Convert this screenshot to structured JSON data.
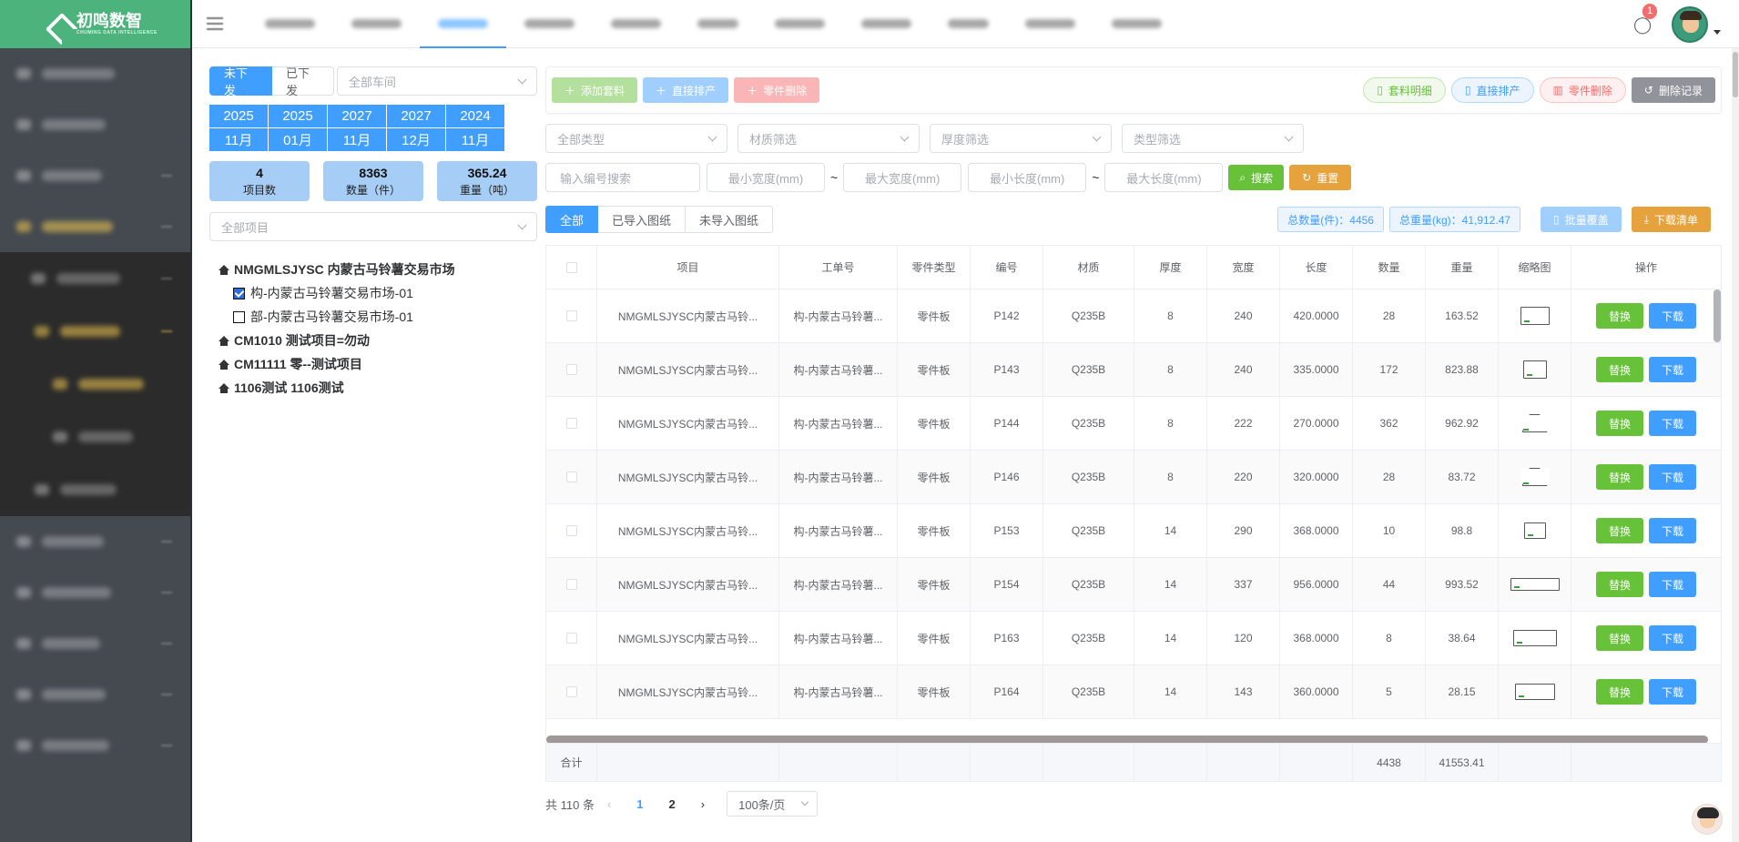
{
  "app": {
    "logo_text": "初鸣数智",
    "logo_sub": "CHUMING DATA INTELLIGENCE",
    "notification_count": "1"
  },
  "left": {
    "tabs": [
      "未下发",
      "已下发"
    ],
    "workshop_placeholder": "全部车间",
    "dates": [
      {
        "year": "2025",
        "month": "11月"
      },
      {
        "year": "2025",
        "month": "01月"
      },
      {
        "year": "2027",
        "month": "11月"
      },
      {
        "year": "2027",
        "month": "12月"
      },
      {
        "year": "2024",
        "month": "11月"
      }
    ],
    "stats": [
      {
        "value": "4",
        "label": "项目数"
      },
      {
        "value": "8363",
        "label": "数量（件）"
      },
      {
        "value": "365.24",
        "label": "重量（吨）"
      }
    ],
    "project_placeholder": "全部项目",
    "tree": {
      "root1": "NMGMLSJYSC 内蒙古马铃薯交易市场",
      "child1": "构-内蒙古马铃薯交易市场-01",
      "child2": "部-内蒙古马铃薯交易市场-01",
      "root2": "CM1010 测试项目=勿动",
      "root3": "CM11111 零--测试项目",
      "root4": "1106测试 1106测试"
    }
  },
  "toolbar": {
    "add_label": "添加套料",
    "direct_label": "直接排产",
    "delete_label": "零件删除",
    "detail_label": "套料明细",
    "direct2_label": "直接排产",
    "delete2_label": "零件删除",
    "records_label": "删除记录"
  },
  "filters": {
    "type": "全部类型",
    "material": "材质筛选",
    "thickness": "厚度筛选",
    "kind": "类型筛选",
    "code": "输入编号搜索",
    "min_w": "最小宽度(mm)",
    "max_w": "最大宽度(mm)",
    "min_l": "最小长度(mm)",
    "max_l": "最大长度(mm)",
    "tilde": "~",
    "search_label": "搜索",
    "reset_label": "重置"
  },
  "view": {
    "tabs": [
      "全部",
      "已导入图纸",
      "未导入图纸"
    ],
    "total_qty": "总数量(件)：4456",
    "total_weight": "总重量(kg)：41,912.47",
    "batch_label": "批量覆盖",
    "download_label": "下载清单"
  },
  "table": {
    "headers": [
      "项目",
      "工单号",
      "零件类型",
      "编号",
      "材质",
      "厚度",
      "宽度",
      "长度",
      "数量",
      "重量",
      "缩略图",
      "操作"
    ],
    "replace_label": "替换",
    "download_label": "下载",
    "rows": [
      {
        "project": "NMGMLSJYSC内蒙古马铃...",
        "order": "构-内蒙古马铃薯...",
        "type": "零件板",
        "code": "P142",
        "mat": "Q235B",
        "thick": "8",
        "width": "240",
        "length": "420.0000",
        "qty": "28",
        "weight": "163.52"
      },
      {
        "project": "NMGMLSJYSC内蒙古马铃...",
        "order": "构-内蒙古马铃薯...",
        "type": "零件板",
        "code": "P143",
        "mat": "Q235B",
        "thick": "8",
        "width": "240",
        "length": "335.0000",
        "qty": "172",
        "weight": "823.88"
      },
      {
        "project": "NMGMLSJYSC内蒙古马铃...",
        "order": "构-内蒙古马铃薯...",
        "type": "零件板",
        "code": "P144",
        "mat": "Q235B",
        "thick": "8",
        "width": "222",
        "length": "270.0000",
        "qty": "362",
        "weight": "962.92"
      },
      {
        "project": "NMGMLSJYSC内蒙古马铃...",
        "order": "构-内蒙古马铃薯...",
        "type": "零件板",
        "code": "P146",
        "mat": "Q235B",
        "thick": "8",
        "width": "220",
        "length": "320.0000",
        "qty": "28",
        "weight": "83.72"
      },
      {
        "project": "NMGMLSJYSC内蒙古马铃...",
        "order": "构-内蒙古马铃薯...",
        "type": "零件板",
        "code": "P153",
        "mat": "Q235B",
        "thick": "14",
        "width": "290",
        "length": "368.0000",
        "qty": "10",
        "weight": "98.8"
      },
      {
        "project": "NMGMLSJYSC内蒙古马铃...",
        "order": "构-内蒙古马铃薯...",
        "type": "零件板",
        "code": "P154",
        "mat": "Q235B",
        "thick": "14",
        "width": "337",
        "length": "956.0000",
        "qty": "44",
        "weight": "993.52"
      },
      {
        "project": "NMGMLSJYSC内蒙古马铃...",
        "order": "构-内蒙古马铃薯...",
        "type": "零件板",
        "code": "P163",
        "mat": "Q235B",
        "thick": "14",
        "width": "120",
        "length": "368.0000",
        "qty": "8",
        "weight": "38.64"
      },
      {
        "project": "NMGMLSJYSC内蒙古马铃...",
        "order": "构-内蒙古马铃薯...",
        "type": "零件板",
        "code": "P164",
        "mat": "Q235B",
        "thick": "14",
        "width": "143",
        "length": "360.0000",
        "qty": "5",
        "weight": "28.15"
      }
    ],
    "footer": {
      "label": "合计",
      "qty": "4438",
      "weight": "41553.41"
    }
  },
  "pager": {
    "total": "共 110 条",
    "page1": "1",
    "page2": "2",
    "size": "100条/页"
  }
}
